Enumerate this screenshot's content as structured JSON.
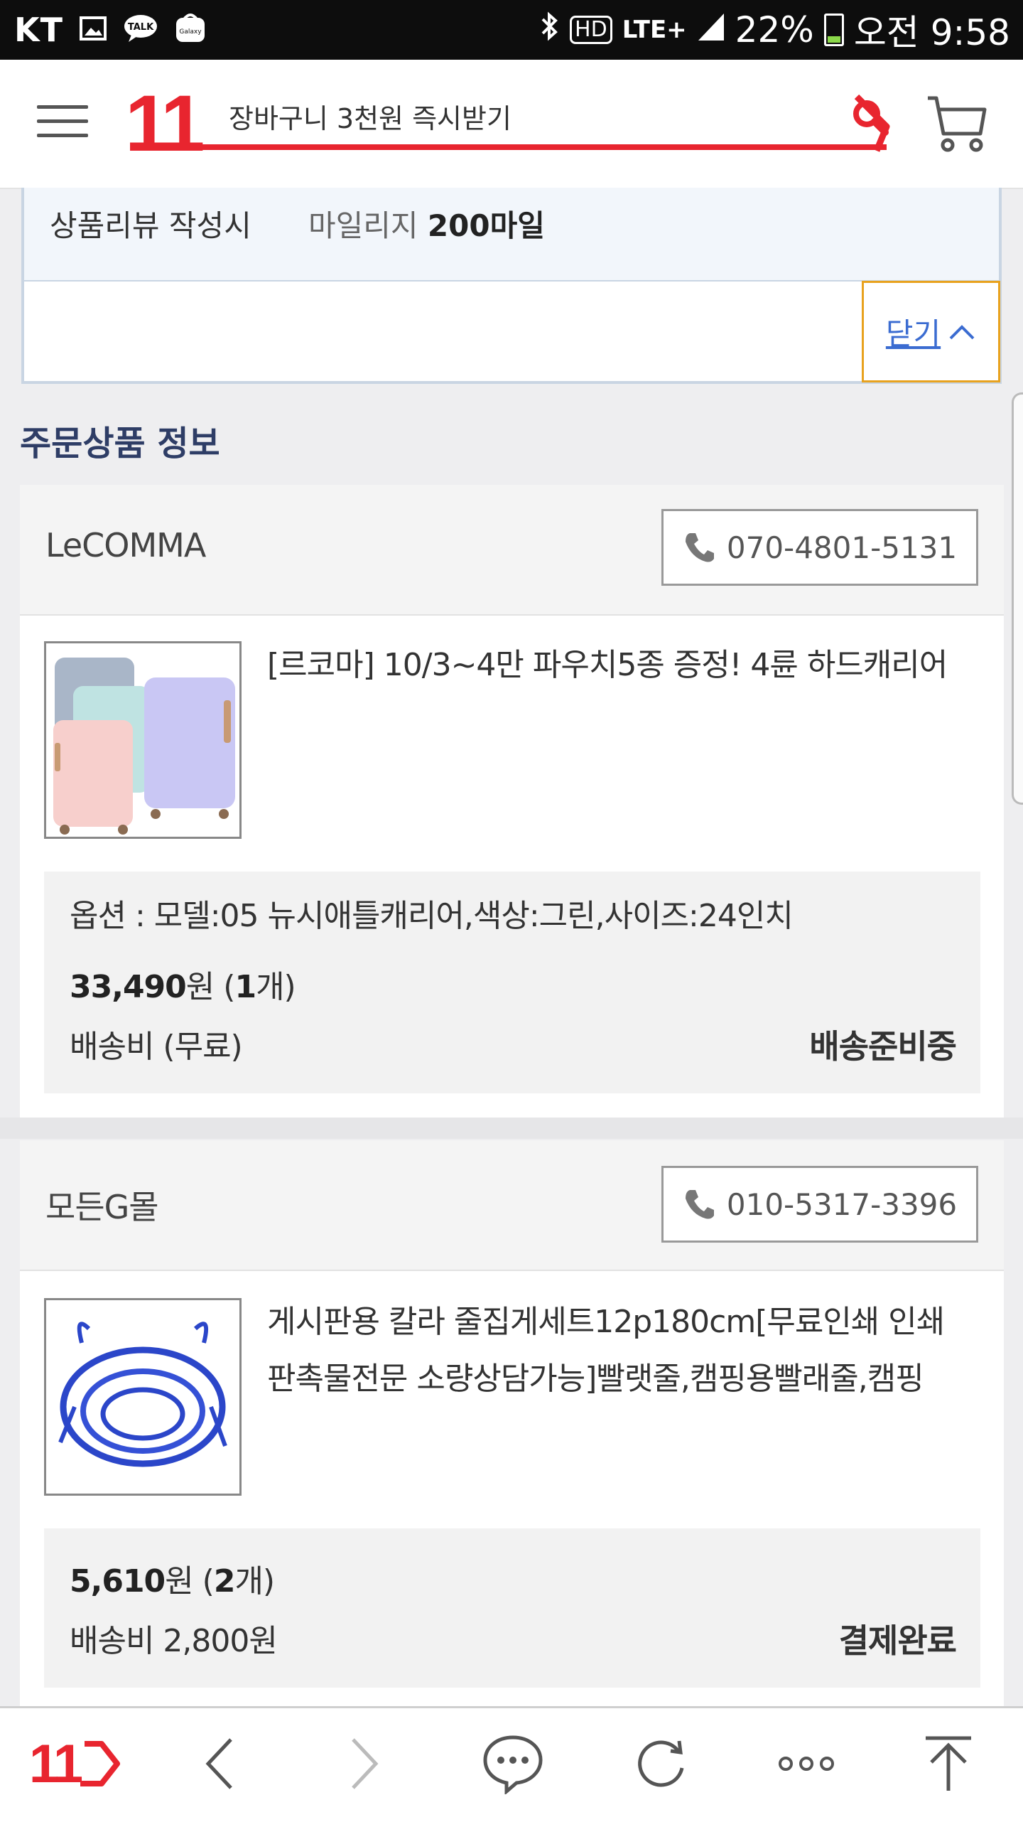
{
  "status_bar": {
    "carrier": "KT",
    "hd": "HD",
    "network": "LTE+",
    "battery": "22%",
    "time": "오전 9:58",
    "talk_badge": "TALK",
    "galaxy_badge": "Galaxy",
    "battery_level": 0.22
  },
  "header": {
    "logo": "11",
    "search_text": "장바구니 3천원 즉시받기"
  },
  "benefit": {
    "label": "상품리뷰 작성시",
    "mileage_prefix": "마일리지",
    "mileage_value": "200마일",
    "close_label": "닫기"
  },
  "section_title": "주문상품 정보",
  "orders": [
    {
      "seller": "LeCOMMA",
      "phone": "070-4801-5131",
      "product_name": "[르코마] 10/3~4만 파우치5종 증정! 4륜 하드캐리어",
      "option": "옵션 : 모델:05 뉴시애틀캐리어,색상:그린,사이즈:24인치",
      "price": "33,490",
      "price_suffix": "원 (",
      "qty": "1",
      "qty_suffix": "개)",
      "shipping": "배송비 (무료)",
      "status": "배송준비중"
    },
    {
      "seller": "모든G몰",
      "phone": "010-5317-3396",
      "product_name_line1": "게시판용 칼라 줄집게세트12p180cm[무료인쇄 인쇄",
      "product_name_line2": "판촉물전문 소량상담가능]빨랫줄,캠핑용빨래줄,캠핑",
      "price": "5,610",
      "price_suffix": "원 (",
      "qty": "2",
      "qty_suffix": "개)",
      "shipping": "배송비 2,800원",
      "status": "결제완료"
    }
  ],
  "bottom_nav": {
    "logo": "11"
  },
  "colors": {
    "brand_red": "#e8252f",
    "section_title": "#2e3d66",
    "link_blue": "#3b6cd1",
    "close_border": "#e8a21e"
  }
}
